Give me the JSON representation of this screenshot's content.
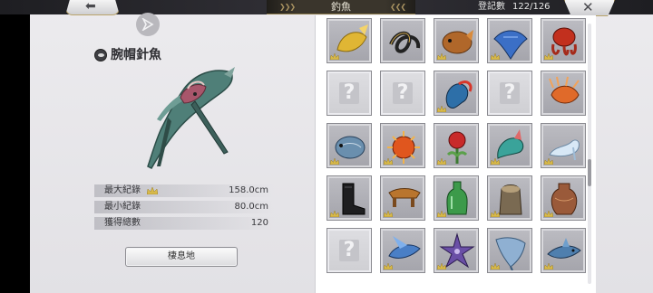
{
  "header": {
    "title": "釣魚",
    "back_icon": "back-arrow-icon",
    "close_icon": "close-x-icon",
    "count_label": "登記數",
    "count_value": "122/126"
  },
  "detail": {
    "fish_name": "腕帽針魚",
    "share_icon": "share-icon",
    "stats": [
      {
        "label": "最大紀錄",
        "value": "158.0cm",
        "crown": true
      },
      {
        "label": "最小紀錄",
        "value": "80.0cm",
        "crown": false
      },
      {
        "label": "獲得總數",
        "value": "120",
        "crown": false
      }
    ],
    "habitat_button": "棲息地"
  },
  "grid": {
    "rows": [
      [
        "golden-fish",
        "black-eel-knot",
        "brown-pufferfish",
        "blue-manta-ray",
        "red-octopus"
      ],
      [
        "unknown",
        "unknown",
        "red-blue-seahorse",
        "unknown",
        "orange-lionfish"
      ],
      [
        "armored-blue-fish",
        "orange-sea-urchin",
        "red-flower-seaweed",
        "teal-sea-dragon",
        "glass-slipper"
      ],
      [
        "black-boot",
        "wooden-geta",
        "green-bottle",
        "old-tree-stump",
        "clay-pot"
      ],
      [
        "unknown",
        "blue-flying-fish",
        "purple-starfish",
        "pale-ray",
        "blue-shark"
      ]
    ],
    "crowns": [
      [
        true,
        false,
        true,
        true,
        true
      ],
      [
        false,
        false,
        true,
        false,
        false
      ],
      [
        true,
        true,
        true,
        true,
        true
      ],
      [
        true,
        true,
        true,
        true,
        true
      ],
      [
        false,
        true,
        true,
        true,
        true
      ]
    ]
  },
  "colors": {
    "accent_gold": "#b9a46a",
    "panel_bg": "#e8e7ea",
    "grid_bg": "#ffffff"
  }
}
